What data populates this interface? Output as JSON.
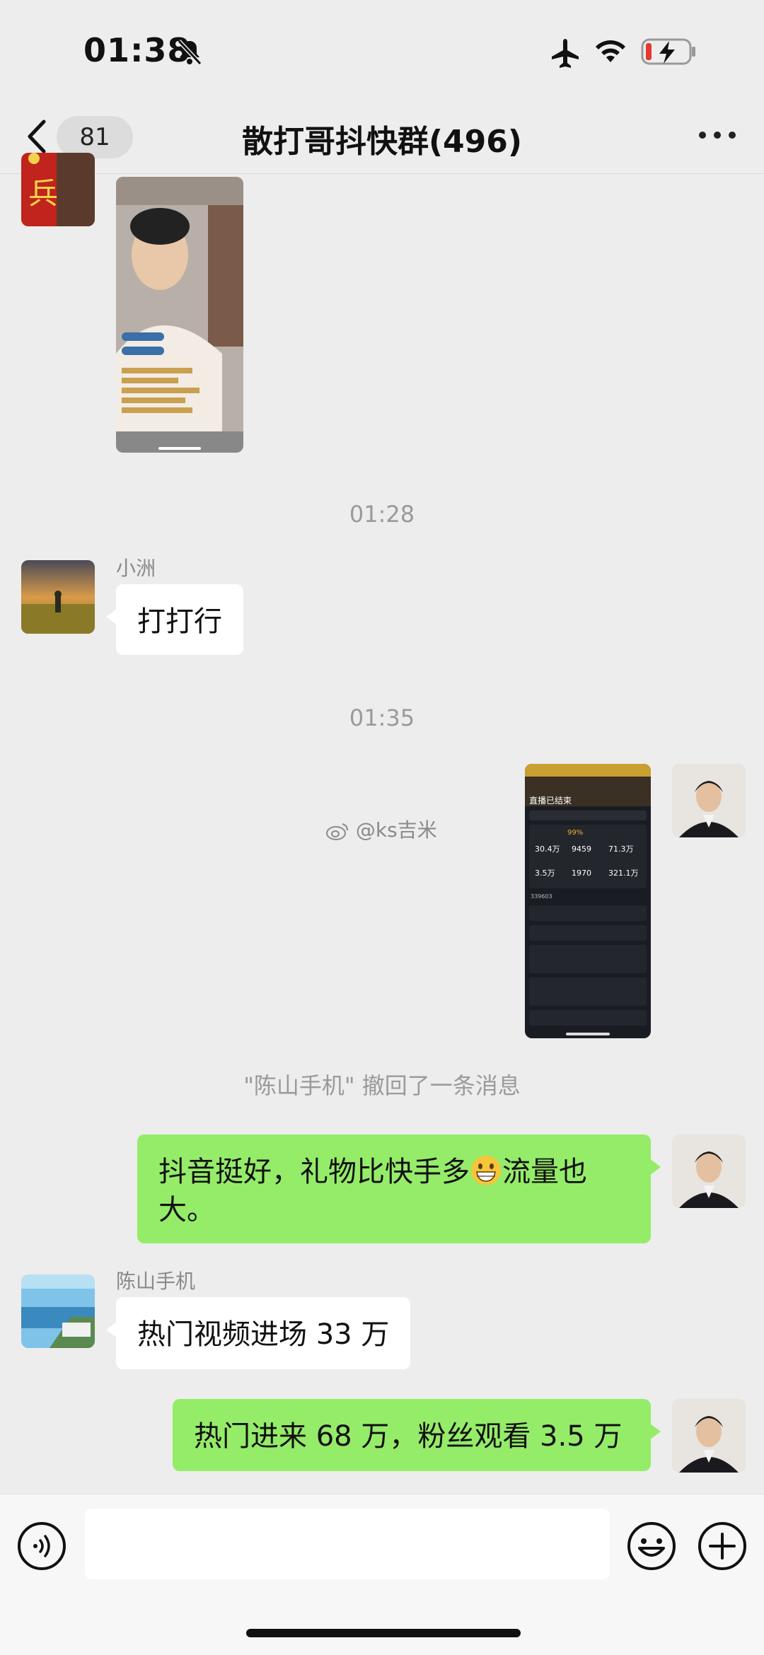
{
  "status_bar": {
    "time": "01:38"
  },
  "nav": {
    "back_count": "81",
    "title": "散打哥抖快群(496)"
  },
  "messages": {
    "timestamp_1": "01:28",
    "msg_1": {
      "sender": "小洲",
      "text": "打打行"
    },
    "timestamp_2": "01:35",
    "watermark": "@ks吉米",
    "system_recall": "\"陈山手机\" 撤回了一条消息",
    "msg_3": {
      "text": "抖音挺好，礼物比快手多",
      "text_after_emoji": "流量也大。",
      "emoji": "grinning-face-emoji"
    },
    "msg_4": {
      "sender": "陈山手机",
      "text": "热门视频进场 33 万"
    },
    "msg_5": {
      "text": "热门进来 68 万，粉丝观看 3.5 万"
    }
  },
  "screenshot_thumb": {
    "header": "直播已结束",
    "pct": "99%",
    "stats": [
      "30.4万",
      "9459",
      "71.3万",
      "3.5万",
      "1970",
      "321.1万"
    ],
    "count": "339603"
  },
  "colors": {
    "bubble_green": "#95ec69",
    "bubble_white": "#ffffff",
    "background": "#ededed"
  }
}
